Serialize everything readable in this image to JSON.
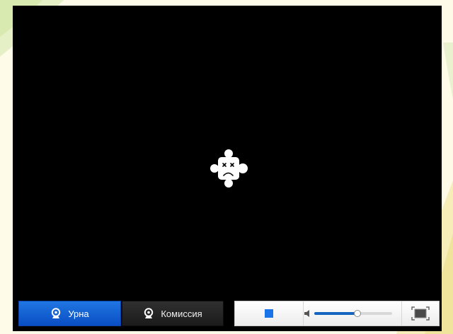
{
  "player": {
    "tabs": [
      {
        "label": "Урна",
        "icon": "webcam-icon",
        "active": true
      },
      {
        "label": "Комиссия",
        "icon": "webcam-icon",
        "active": false
      }
    ],
    "error_icon": "missing-plugin-icon",
    "volume_level": 0.55,
    "colors": {
      "active_tab": "#0f5cd2",
      "inactive_tab": "#262626",
      "stop": "#1a73e8",
      "volume_fill": "#1565c0"
    }
  }
}
